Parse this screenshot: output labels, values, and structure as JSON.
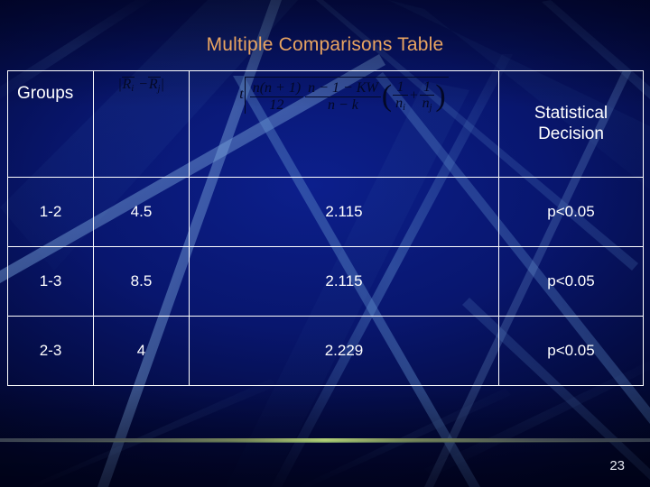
{
  "slide": {
    "title": "Multiple Comparisons Table",
    "page_number": "23",
    "title_color": "#e9a461",
    "background_color": "#061078",
    "text_color": "#ffffff"
  },
  "table": {
    "columns": [
      {
        "key": "groups",
        "header": "Groups"
      },
      {
        "key": "diff",
        "header": "|Ri - Rj|"
      },
      {
        "key": "critical",
        "header": "t sqrt( (n(n+1)/12) ((n-1-KW)/(n-k)) (1/ni + 1/nj) )"
      },
      {
        "key": "decision",
        "header": "Statistical Decision"
      }
    ],
    "header": {
      "groups_label": "Groups",
      "decision_label_line1": "Statistical",
      "decision_label_line2": "Decision",
      "formula_diff": {
        "left_bar": "|",
        "r_bar": "R",
        "sub_i": "i",
        "minus": "−",
        "r_bar2": "R",
        "sub_j": "j",
        "right_bar": "|"
      },
      "formula_critical": {
        "t": "t",
        "frac1_num": "n(n + 1)",
        "frac1_den": "12",
        "frac2_num": "n − 1 − KW",
        "frac2_den": "n − k",
        "frac3_num": "1",
        "frac3_den": "n",
        "frac3_den_sub": "i",
        "plus": "+",
        "frac4_num": "1",
        "frac4_den": "n",
        "frac4_den_sub": "j",
        "paren_open": "(",
        "paren_close": ")"
      }
    },
    "rows": [
      {
        "groups": "1-2",
        "diff": "4.5",
        "critical": "2.115",
        "decision": "p<0.05"
      },
      {
        "groups": "1-3",
        "diff": "8.5",
        "critical": "2.115",
        "decision": "p<0.05"
      },
      {
        "groups": "2-3",
        "diff": "4",
        "critical": "2.229",
        "decision": "p<0.05"
      }
    ]
  }
}
